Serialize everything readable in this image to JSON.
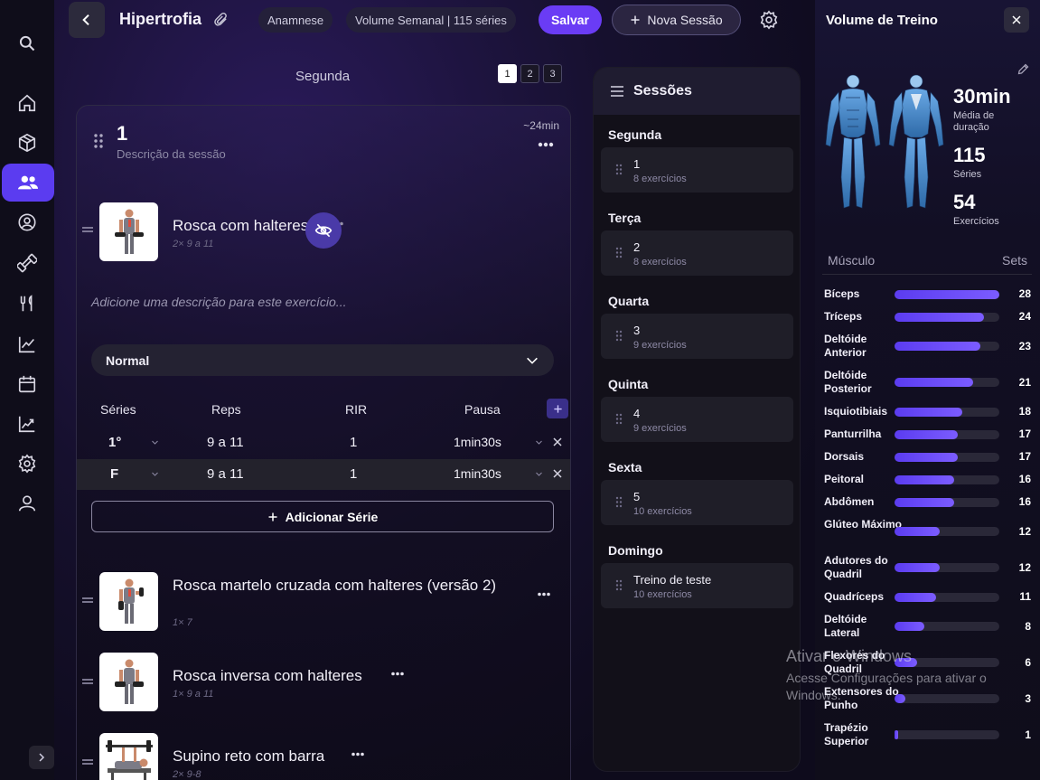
{
  "nav": {
    "items": [
      {
        "icon": "search-icon"
      },
      {
        "icon": "home-icon"
      },
      {
        "icon": "box-icon"
      },
      {
        "icon": "users-icon",
        "active": true
      },
      {
        "icon": "profile-icon"
      },
      {
        "icon": "dumbbell-icon"
      },
      {
        "icon": "utensils-icon"
      },
      {
        "icon": "chart-line-icon"
      },
      {
        "icon": "calendar-icon"
      },
      {
        "icon": "trend-icon"
      },
      {
        "icon": "gear-icon"
      },
      {
        "icon": "user-icon"
      }
    ]
  },
  "header": {
    "title": "Hipertrofia",
    "chips": [
      "Anamnese",
      "Volume Semanal | 115 séries"
    ],
    "save_label": "Salvar",
    "new_session_label": "Nova Sessão"
  },
  "day": {
    "label": "Segunda",
    "pages": [
      "1",
      "2",
      "3"
    ],
    "active_page": "1"
  },
  "session": {
    "number": "1",
    "description_placeholder": "Descrição da sessão",
    "duration": "~24min"
  },
  "exercise_open": {
    "name": "Rosca com halteres",
    "sets_summary": "2× 9 a 11",
    "note_placeholder": "Adicione uma descrição para este exercício...",
    "method": "Normal",
    "columns": [
      "Séries",
      "Reps",
      "RIR",
      "Pausa"
    ],
    "rows": [
      {
        "serie": "1°",
        "reps": "9 a 11",
        "rir": "1",
        "pausa": "1min30s"
      },
      {
        "serie": "F",
        "reps": "9 a 11",
        "rir": "1",
        "pausa": "1min30s"
      }
    ],
    "add_set_label": "Adicionar Série"
  },
  "exercises": [
    {
      "name": "Rosca martelo cruzada com halteres (versão 2)",
      "sets_summary": "1× 7"
    },
    {
      "name": "Rosca inversa com halteres",
      "sets_summary": "1× 9 a 11"
    },
    {
      "name": "Supino reto com barra",
      "sets_summary": "2× 9-8"
    }
  ],
  "sessions_panel": {
    "title": "Sessões",
    "days": [
      {
        "day": "Segunda",
        "name": "1",
        "count": "8 exercícios"
      },
      {
        "day": "Terça",
        "name": "2",
        "count": "8 exercícios"
      },
      {
        "day": "Quarta",
        "name": "3",
        "count": "9 exercícios"
      },
      {
        "day": "Quinta",
        "name": "4",
        "count": "9 exercícios"
      },
      {
        "day": "Sexta",
        "name": "5",
        "count": "10 exercícios"
      },
      {
        "day": "Domingo",
        "name": "Treino de teste",
        "count": "10 exercícios"
      }
    ]
  },
  "volume": {
    "title": "Volume de Treino",
    "stats": [
      {
        "value": "30min",
        "label": "Média de duração"
      },
      {
        "value": "115",
        "label": "Séries"
      },
      {
        "value": "54",
        "label": "Exercícios"
      }
    ],
    "col_muscle": "Músculo",
    "col_sets": "Sets",
    "max_sets": 28,
    "muscles": [
      {
        "name": "Bíceps",
        "sets": 28
      },
      {
        "name": "Tríceps",
        "sets": 24
      },
      {
        "name": "Deltóide Anterior",
        "sets": 23
      },
      {
        "name": "Deltóide Posterior",
        "sets": 21
      },
      {
        "name": "Isquiotibiais",
        "sets": 18
      },
      {
        "name": "Panturrilha",
        "sets": 17
      },
      {
        "name": "Dorsais",
        "sets": 17
      },
      {
        "name": "Peitoral",
        "sets": 16
      },
      {
        "name": "Abdômen",
        "sets": 16
      },
      {
        "name": "Glúteo Máximo",
        "sets": 12
      },
      {
        "name": "Adutores do Quadril",
        "sets": 12
      },
      {
        "name": "Quadríceps",
        "sets": 11
      },
      {
        "name": "Deltóide Lateral",
        "sets": 8
      },
      {
        "name": "Flexores do Quadril",
        "sets": 6
      },
      {
        "name": "Extensores do Punho",
        "sets": 3
      },
      {
        "name": "Trapézio Superior",
        "sets": 1
      }
    ]
  },
  "os_watermark": {
    "line1": "Ativar o Windows",
    "line2": "Acesse Configurações para ativar o Windows."
  }
}
